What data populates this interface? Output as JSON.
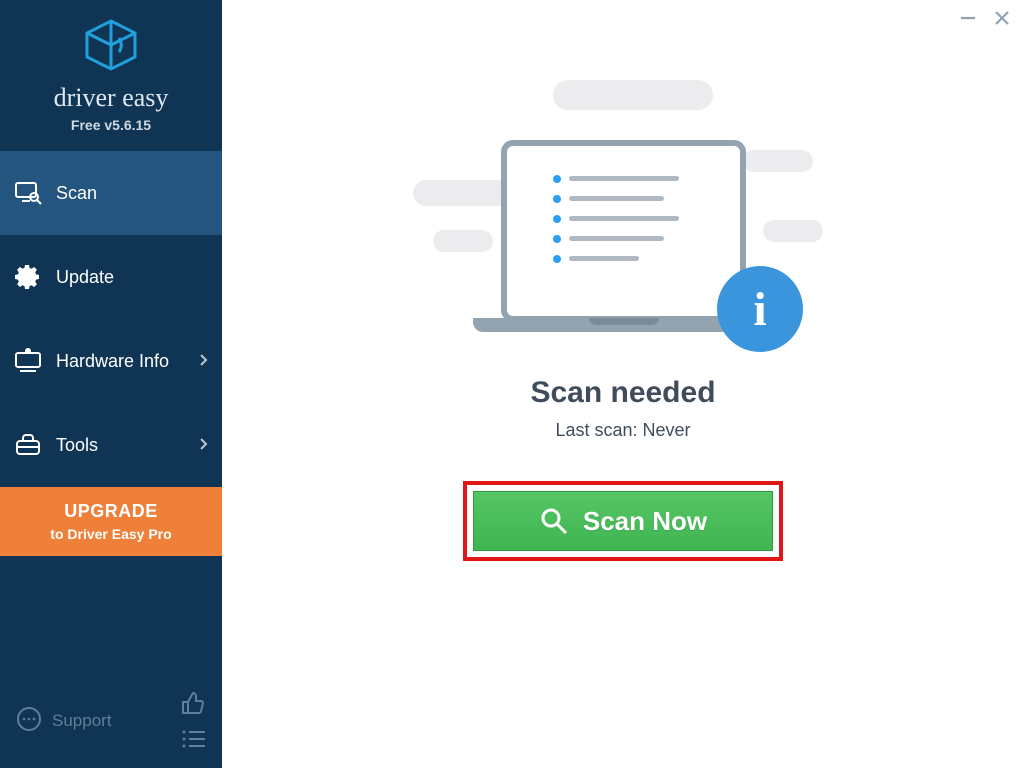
{
  "brand": {
    "name": "driver easy",
    "version": "Free v5.6.15"
  },
  "sidebar": {
    "items": [
      {
        "label": "Scan"
      },
      {
        "label": "Update"
      },
      {
        "label": "Hardware Info"
      },
      {
        "label": "Tools"
      }
    ],
    "upgrade": {
      "title": "UPGRADE",
      "sub": "to Driver Easy Pro"
    },
    "support": "Support"
  },
  "main": {
    "headline": "Scan needed",
    "subline": "Last scan: Never",
    "scan_label": "Scan Now"
  }
}
